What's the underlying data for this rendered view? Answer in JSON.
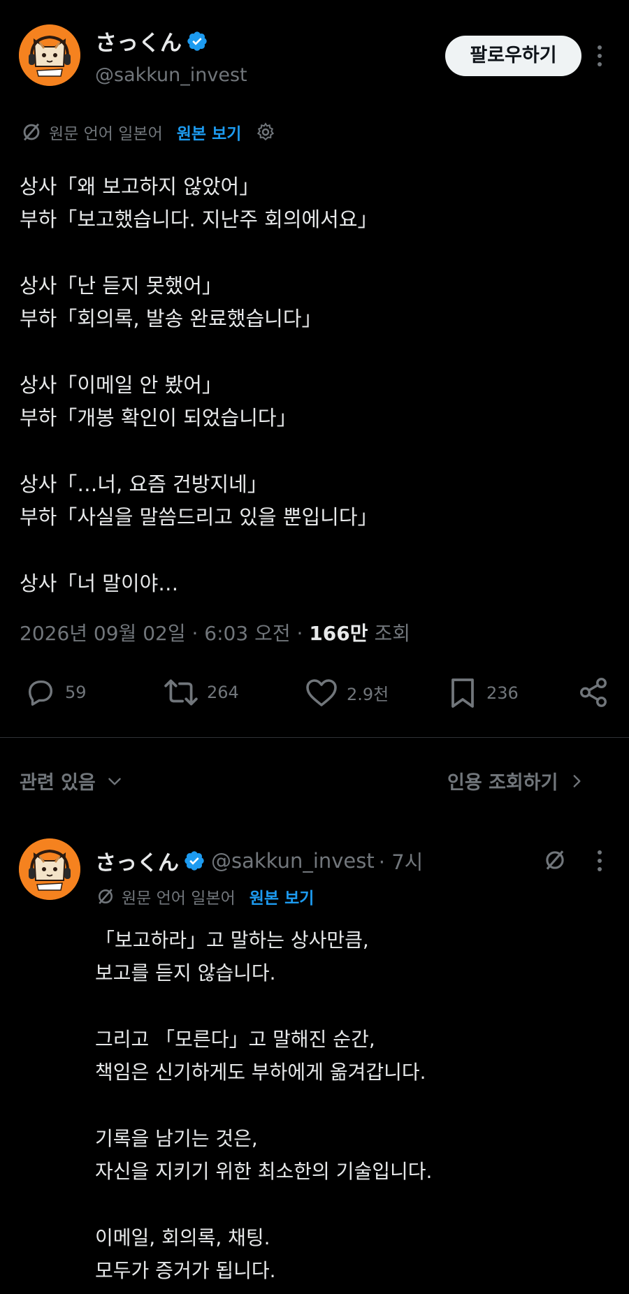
{
  "author": {
    "display_name": "さっくん",
    "handle": "@sakkun_invest",
    "avatar_icon": "cat-avatar-icon",
    "verified_icon": "verified-badge-icon"
  },
  "follow_button": {
    "label": "팔로우하기"
  },
  "more_icon": "more-vertical-icon",
  "translation": {
    "icon": "translate-icon",
    "label": "원문 언어 일본어",
    "view_original": "원본 보기",
    "settings_icon": "gear-icon"
  },
  "tweet": {
    "lines": [
      "상사「왜 보고하지 않았어」",
      "부하「보고했습니다. 지난주 회의에서요」",
      "",
      "상사「난 듣지 못했어」",
      "부하「회의록, 발송 완료했습니다」",
      "",
      "상사「이메일 안 봤어」",
      "부하「개봉 확인이 되었습니다」",
      "",
      "상사「…너, 요즘 건방지네」",
      "부하「사실을 말씀드리고 있을 뿐입니다」",
      "",
      "상사「너 말이야…"
    ],
    "meta_date": "2026년 09월 02일 · 6:03 오전 ·",
    "meta_views": "166만",
    "meta_views_label": "조회"
  },
  "actions": {
    "reply": {
      "icon": "reply-icon",
      "count": "59"
    },
    "retweet": {
      "icon": "retweet-icon",
      "count": "264"
    },
    "like": {
      "icon": "heart-icon",
      "count": "2.9천"
    },
    "bookmark": {
      "icon": "bookmark-icon",
      "count": "236"
    },
    "share": {
      "icon": "share-icon"
    }
  },
  "related": {
    "label": "관련 있음",
    "quotes_label": "인용 조회하기"
  },
  "reply_tweet": {
    "display_name": "さっくん",
    "handle": "@sakkun_invest",
    "time": "· 7시",
    "translation_label": "원문 언어 일본어",
    "view_original": "원본 보기",
    "lines": [
      "「보고하라」고 말하는 상사만큼,",
      "보고를 듣지 않습니다.",
      "",
      "그리고 「모른다」고 말해진 순간,",
      "책임은 신기하게도 부하에게 옮겨갑니다.",
      "",
      "기록을 남기는 것은,",
      "자신을 지키기 위한 최소한의 기술입니다.",
      "",
      "이메일, 회의록, 채팅.",
      "모두가 증거가 됩니다."
    ]
  },
  "colors": {
    "background": "#000000",
    "text": "#e7e9ea",
    "muted": "#71767b",
    "accent_blue": "#1d9bf0",
    "avatar_orange": "#f5821f"
  }
}
